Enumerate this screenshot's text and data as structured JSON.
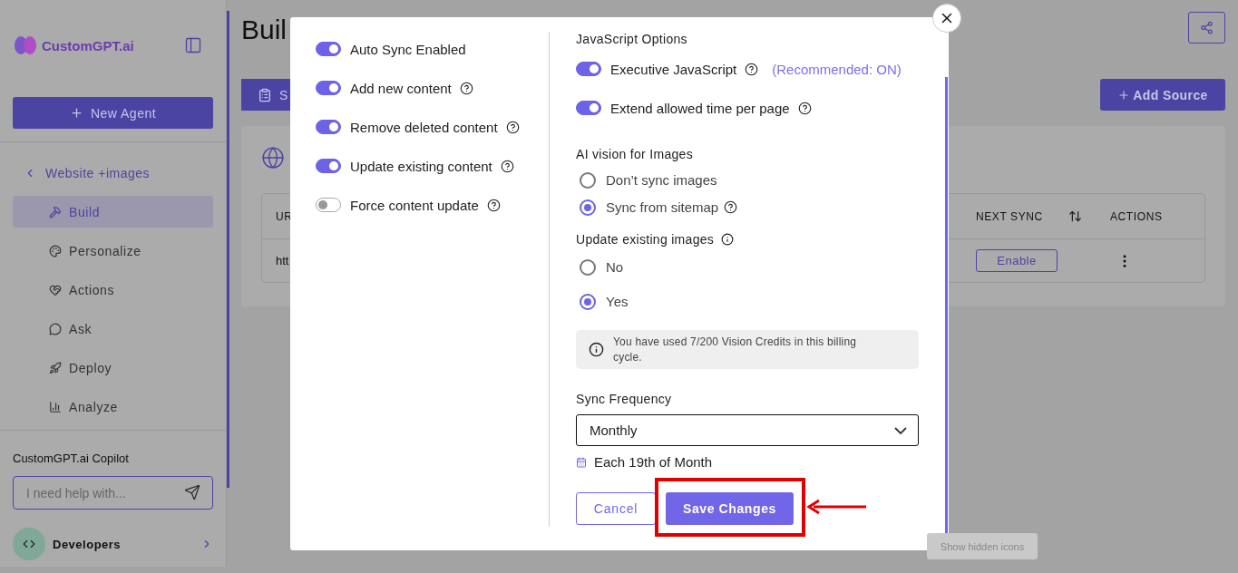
{
  "sidebar": {
    "brand": "CustomGPT.ai",
    "new_agent": "New Agent",
    "back_link": "Website +images",
    "items": [
      {
        "label": "Build",
        "selected": true
      },
      {
        "label": "Personalize",
        "selected": false
      },
      {
        "label": "Actions",
        "selected": false
      },
      {
        "label": "Ask",
        "selected": false
      },
      {
        "label": "Deploy",
        "selected": false
      },
      {
        "label": "Analyze",
        "selected": false
      }
    ],
    "copilot": {
      "title": "CustomGPT.ai Copilot",
      "placeholder": "I need help with..."
    },
    "footer": {
      "label": "Developers"
    }
  },
  "main": {
    "title": "Buil",
    "tab": "S",
    "add_source": "Add Source",
    "table": {
      "columns": [
        "UR",
        "NEXT SYNC",
        "ACTIONS"
      ],
      "rows": [
        {
          "url": "htt",
          "next_sync": "Enable"
        }
      ]
    }
  },
  "dialog": {
    "toggles": [
      {
        "label": "Auto Sync Enabled",
        "on": true,
        "help": false
      },
      {
        "label": "Add new content",
        "on": true,
        "help": true
      },
      {
        "label": "Remove deleted content",
        "on": true,
        "help": true
      },
      {
        "label": "Update existing content",
        "on": true,
        "help": true
      },
      {
        "label": "Force content update",
        "on": false,
        "help": true
      }
    ],
    "js_title": "JavaScript Options",
    "js_toggles": [
      {
        "label": "Executive JavaScript",
        "on": true,
        "help": true,
        "note": "(Recommended: ON)"
      },
      {
        "label": "Extend allowed time per page",
        "on": true,
        "help": true
      }
    ],
    "vision": {
      "title": "AI vision for Images",
      "options": [
        {
          "label": "Don’t sync images",
          "selected": false,
          "help": false
        },
        {
          "label": "Sync from sitemap",
          "selected": true,
          "help": true
        }
      ]
    },
    "update_images": {
      "title": "Update existing images",
      "options": [
        {
          "label": "No",
          "selected": false
        },
        {
          "label": "Yes",
          "selected": true
        }
      ]
    },
    "credits_note": "You have used 7/200 Vision Credits in this billing cycle.",
    "frequency": {
      "label": "Sync Frequency",
      "value": "Monthly"
    },
    "schedule": "Each 19th of Month",
    "cancel": "Cancel",
    "save": "Save Changes"
  },
  "tooltip": "Show hidden icons"
}
